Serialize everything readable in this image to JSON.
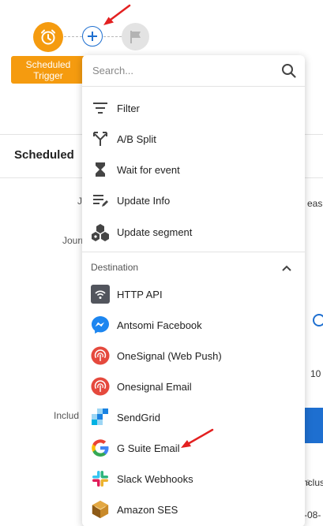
{
  "canvas": {
    "trigger_label": "Scheduled Trigger",
    "accent_color": "#f59b0f",
    "plus_color": "#1e6fd0"
  },
  "background": {
    "panel_title": "Scheduled",
    "label_ju": "Ju",
    "label_journ": "Journ",
    "label_includ": "Includ",
    "frag_easu": "easu",
    "frag_10": "10",
    "frag_s": "s",
    "frag_inclusi": "nclusi",
    "frag_date": "-08-"
  },
  "menu": {
    "search_placeholder": "Search...",
    "actions": [
      {
        "label": "Filter",
        "icon": "filter-icon"
      },
      {
        "label": "A/B Split",
        "icon": "split-icon"
      },
      {
        "label": "Wait for event",
        "icon": "hourglass-icon"
      },
      {
        "label": "Update Info",
        "icon": "edit-list-icon"
      },
      {
        "label": "Update segment",
        "icon": "segment-icon"
      }
    ],
    "destination_header": "Destination",
    "destinations": [
      {
        "label": "HTTP API",
        "icon": "http-api-icon"
      },
      {
        "label": "Antsomi Facebook",
        "icon": "messenger-icon"
      },
      {
        "label": "OneSignal (Web Push)",
        "icon": "onesignal-icon"
      },
      {
        "label": "Onesignal Email",
        "icon": "onesignal-icon"
      },
      {
        "label": "SendGrid",
        "icon": "sendgrid-icon"
      },
      {
        "label": "G Suite Email",
        "icon": "google-icon"
      },
      {
        "label": "Slack Webhooks",
        "icon": "slack-icon"
      },
      {
        "label": "Amazon SES",
        "icon": "amazon-ses-icon"
      }
    ]
  }
}
